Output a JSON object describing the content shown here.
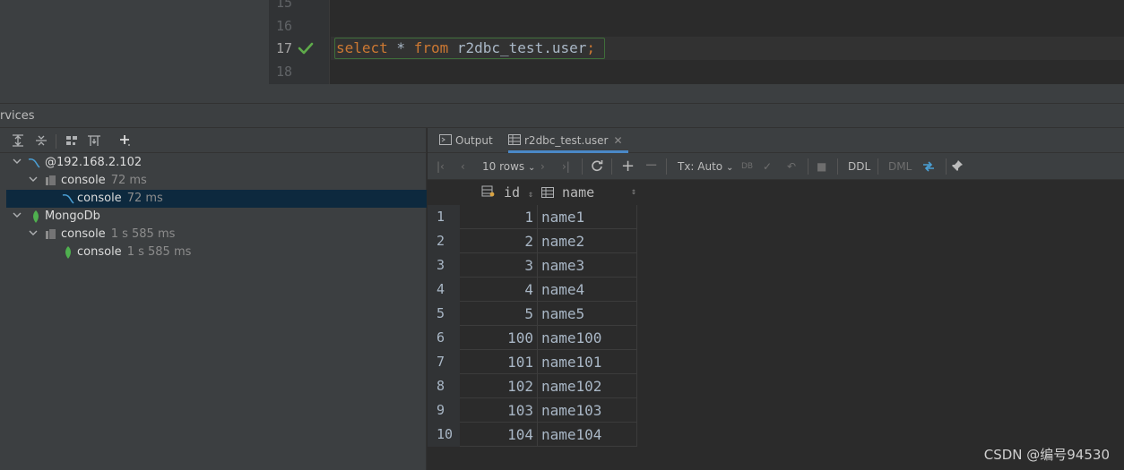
{
  "editor": {
    "line_numbers": [
      "15",
      "16",
      "17",
      "18"
    ],
    "code": {
      "kw1": "select",
      "star": " * ",
      "kw2": "from",
      "rest": " r2dbc_test.user",
      "semi": ";"
    }
  },
  "services": {
    "title": "rvices"
  },
  "tree": {
    "items": [
      {
        "label": "@192.168.2.102",
        "time": ""
      },
      {
        "label": "console",
        "time": "72 ms"
      },
      {
        "label": "console",
        "time": "72 ms"
      },
      {
        "label": "MongoDb",
        "time": ""
      },
      {
        "label": "console",
        "time": "1 s 585 ms"
      },
      {
        "label": "console",
        "time": "1 s 585 ms"
      }
    ]
  },
  "tabs": [
    {
      "label": "Output"
    },
    {
      "label": "r2dbc_test.user"
    }
  ],
  "grid_toolbar": {
    "rows": "10 rows",
    "tx": "Tx: Auto",
    "ddl": "DDL",
    "dml": "DML"
  },
  "table": {
    "columns": [
      "id",
      "name"
    ],
    "rows": [
      {
        "n": "1",
        "id": "1",
        "name": "name1"
      },
      {
        "n": "2",
        "id": "2",
        "name": "name2"
      },
      {
        "n": "3",
        "id": "3",
        "name": "name3"
      },
      {
        "n": "4",
        "id": "4",
        "name": "name4"
      },
      {
        "n": "5",
        "id": "5",
        "name": "name5"
      },
      {
        "n": "6",
        "id": "100",
        "name": "name100"
      },
      {
        "n": "7",
        "id": "101",
        "name": "name101"
      },
      {
        "n": "8",
        "id": "102",
        "name": "name102"
      },
      {
        "n": "9",
        "id": "103",
        "name": "name103"
      },
      {
        "n": "10",
        "id": "104",
        "name": "name104"
      }
    ]
  },
  "watermark": "CSDN @编号94530",
  "colors": {
    "keyword": "#cc7832",
    "selection": "#0d293e",
    "mongo_green": "#4fb04f",
    "mysql_blue": "#4a9fd4"
  }
}
